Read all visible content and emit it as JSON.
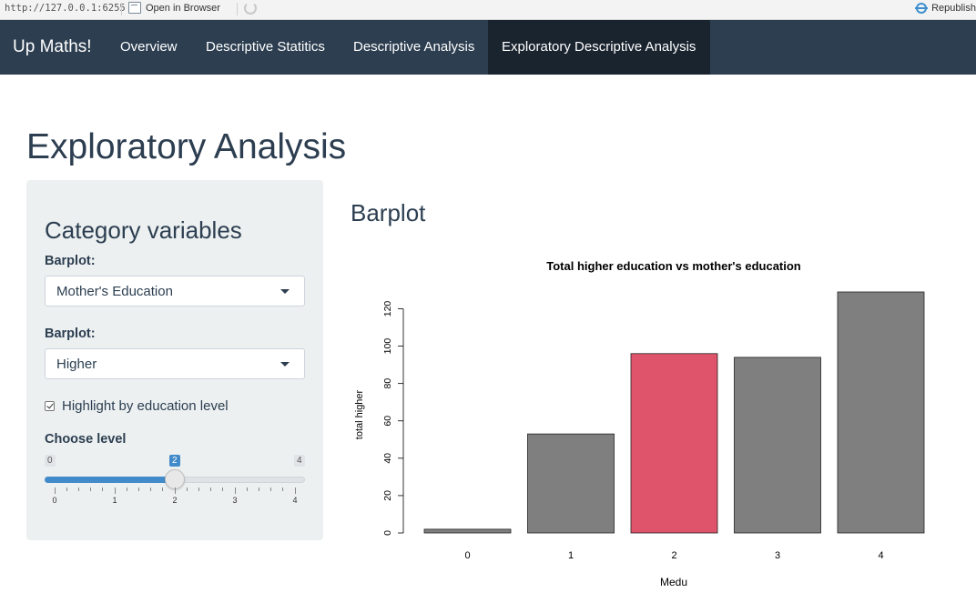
{
  "viewer": {
    "url": "http://127.0.0.1:6255",
    "open_label": "Open in Browser",
    "republish_label": "Republish"
  },
  "navbar": {
    "brand": "Up Maths!",
    "tabs": [
      {
        "label": "Overview",
        "active": false
      },
      {
        "label": "Descriptive Statitics",
        "active": false
      },
      {
        "label": "Descriptive Analysis",
        "active": false
      },
      {
        "label": "Exploratory Descriptive Analysis",
        "active": true
      }
    ]
  },
  "page": {
    "title": "Exploratory Analysis"
  },
  "sidebar": {
    "title": "Category variables",
    "select1": {
      "label": "Barplot:",
      "value": "Mother's Education"
    },
    "select2": {
      "label": "Barplot:",
      "value": "Higher"
    },
    "checkbox": {
      "label": "Highlight by education level",
      "checked": true
    },
    "slider": {
      "label": "Choose level",
      "min": "0",
      "max": "4",
      "value": "2",
      "tick_labels": [
        "0",
        "1",
        "2",
        "3",
        "4"
      ]
    }
  },
  "main": {
    "title": "Barplot"
  },
  "colors": {
    "navbar": "#2c3e50",
    "active_tab": "#1a242f",
    "bar": "#7f7f7f",
    "highlight": "#df536b",
    "slider": "#428bca"
  },
  "chart_data": {
    "type": "bar",
    "title": "Total higher education vs mother's education",
    "xlabel": "Medu",
    "ylabel": "total higher",
    "categories": [
      "0",
      "1",
      "2",
      "3",
      "4"
    ],
    "values": [
      2,
      53,
      96,
      94,
      129
    ],
    "highlight_category": "2",
    "yticks": [
      0,
      20,
      40,
      60,
      80,
      100,
      120
    ],
    "ylim": [
      0,
      129
    ]
  }
}
